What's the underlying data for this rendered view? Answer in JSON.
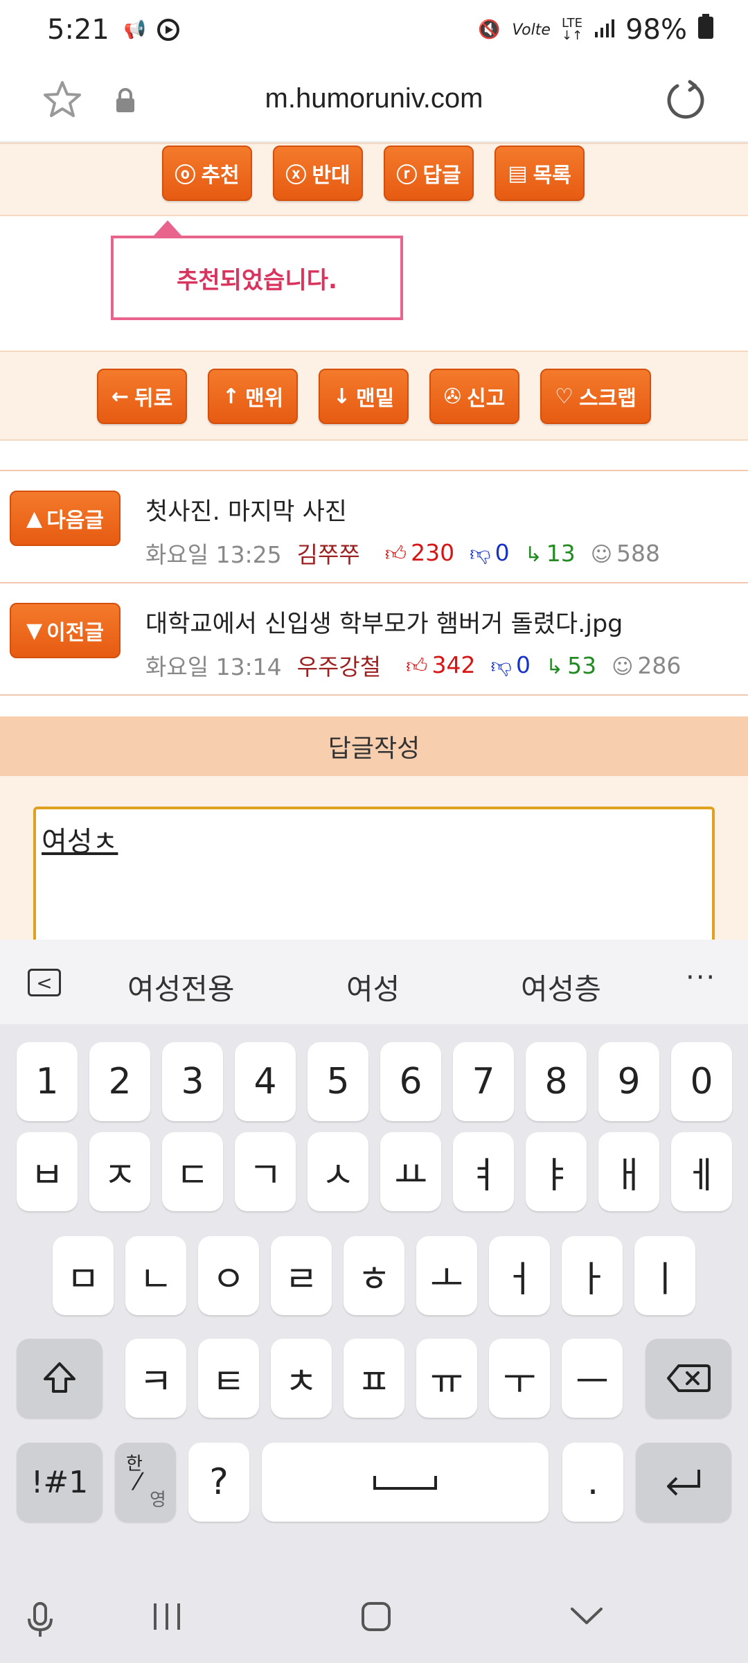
{
  "status": {
    "time": "5:21",
    "battery": "98%",
    "lte": "LTE",
    "volte": "Volte"
  },
  "browser": {
    "url": "m.humoruniv.com"
  },
  "top_actions": [
    {
      "icon": "ⓞ",
      "label": "추천"
    },
    {
      "icon": "ⓧ",
      "label": "반대"
    },
    {
      "icon": "ⓡ",
      "label": "답글"
    },
    {
      "icon": "▤",
      "label": "목록"
    }
  ],
  "toast": {
    "message": "추천되었습니다."
  },
  "mid_actions": [
    {
      "icon": "←",
      "label": "뒤로"
    },
    {
      "icon": "↑",
      "label": "맨위"
    },
    {
      "icon": "↓",
      "label": "맨밑"
    },
    {
      "icon": "✇",
      "label": "신고"
    },
    {
      "icon": "♡",
      "label": "스크랩"
    }
  ],
  "posts": [
    {
      "nav_label": "다음글",
      "nav_icon": "▲",
      "title": "첫사진. 마지막 사진",
      "date": "화요일 13:25",
      "author": "김쭈쭈",
      "up": "230",
      "down": "0",
      "replies": "13",
      "views": "588"
    },
    {
      "nav_label": "이전글",
      "nav_icon": "▼",
      "title": "대학교에서 신입생 학부모가 햄버거 돌렸다.jpg",
      "date": "화요일 13:14",
      "author": "우주강철",
      "up": "342",
      "down": "0",
      "replies": "53",
      "views": "286"
    }
  ],
  "reply": {
    "header": "답글작성",
    "text": "여성ㅊ"
  },
  "keyboard": {
    "suggestions": [
      "여성전용",
      "여성",
      "여성층"
    ],
    "more": "···",
    "row_numbers": [
      "1",
      "2",
      "3",
      "4",
      "5",
      "6",
      "7",
      "8",
      "9",
      "0"
    ],
    "row1": [
      "ㅂ",
      "ㅈ",
      "ㄷ",
      "ㄱ",
      "ㅅ",
      "ㅛ",
      "ㅕ",
      "ㅑ",
      "ㅐ",
      "ㅔ"
    ],
    "row2": [
      "ㅁ",
      "ㄴ",
      "ㅇ",
      "ㄹ",
      "ㅎ",
      "ㅗ",
      "ㅓ",
      "ㅏ",
      "ㅣ"
    ],
    "row3": [
      "ㅋ",
      "ㅌ",
      "ㅊ",
      "ㅍ",
      "ㅠ",
      "ㅜ",
      "ㅡ"
    ],
    "symbols_label": "!#1",
    "lang_top": "한",
    "lang_bottom": "영",
    "question": "?",
    "period": "."
  }
}
